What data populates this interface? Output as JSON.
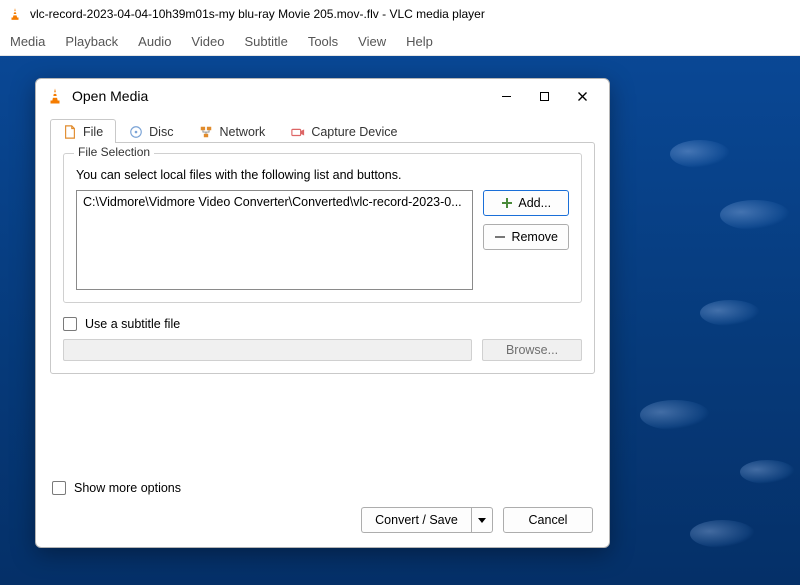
{
  "window": {
    "title": "vlc-record-2023-04-04-10h39m01s-my blu-ray Movie 205.mov-.flv - VLC media player"
  },
  "menubar": {
    "media": "Media",
    "playback": "Playback",
    "audio": "Audio",
    "video": "Video",
    "subtitle": "Subtitle",
    "tools": "Tools",
    "view": "View",
    "help": "Help"
  },
  "dialog": {
    "title": "Open Media",
    "tabs": {
      "file": "File",
      "disc": "Disc",
      "network": "Network",
      "capture": "Capture Device"
    },
    "file_selection": {
      "legend": "File Selection",
      "help": "You can select local files with the following list and buttons.",
      "selected_file": "C:\\Vidmore\\Vidmore Video Converter\\Converted\\vlc-record-2023-0...",
      "add_label": "Add...",
      "remove_label": "Remove"
    },
    "subtitle": {
      "checkbox_label": "Use a subtitle file",
      "browse_label": "Browse..."
    },
    "more_options_label": "Show more options",
    "convert_save_label": "Convert / Save",
    "cancel_label": "Cancel"
  }
}
